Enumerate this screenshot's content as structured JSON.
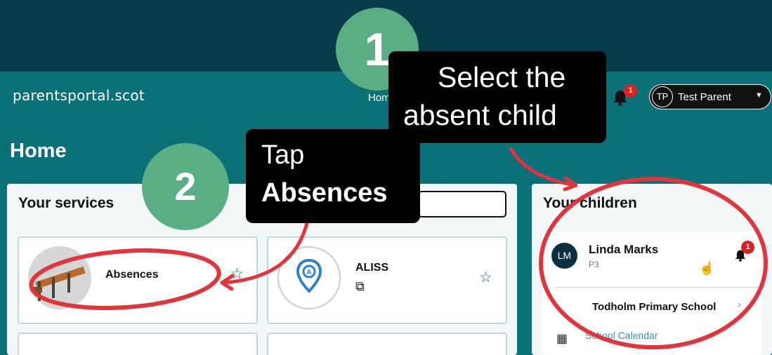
{
  "header": {
    "brand": "parentsportal.scot",
    "nav_home": "Home",
    "notification_count": "1",
    "user": {
      "initials": "TP",
      "name": "Test Parent"
    }
  },
  "page": {
    "title": "Home"
  },
  "services": {
    "title": "Your services",
    "cards": [
      {
        "label": "Absences",
        "icon": "desks-illustration",
        "starred": false
      },
      {
        "label": "ALISS",
        "icon": "location-pin-icon",
        "external": true,
        "starred": false
      }
    ]
  },
  "children": {
    "title": "Your children",
    "items": [
      {
        "initials": "LM",
        "name": "Linda Marks",
        "class": "P3",
        "notification_count": "1",
        "school": "Todholm Primary School",
        "calendar_label": "School Calendar"
      }
    ]
  },
  "annotations": {
    "step1_number": "1",
    "step1_text_line1": "Select the",
    "step1_text_line2": "absent child",
    "step2_number": "2",
    "step2_text_line1": "Tap",
    "step2_text_line2": "Absences"
  },
  "colors": {
    "background_dark": "#063c4a",
    "app_teal": "#0c7079",
    "step_green": "#5aae83",
    "annotation_red": "#e0363b",
    "badge_red": "#e02020"
  }
}
